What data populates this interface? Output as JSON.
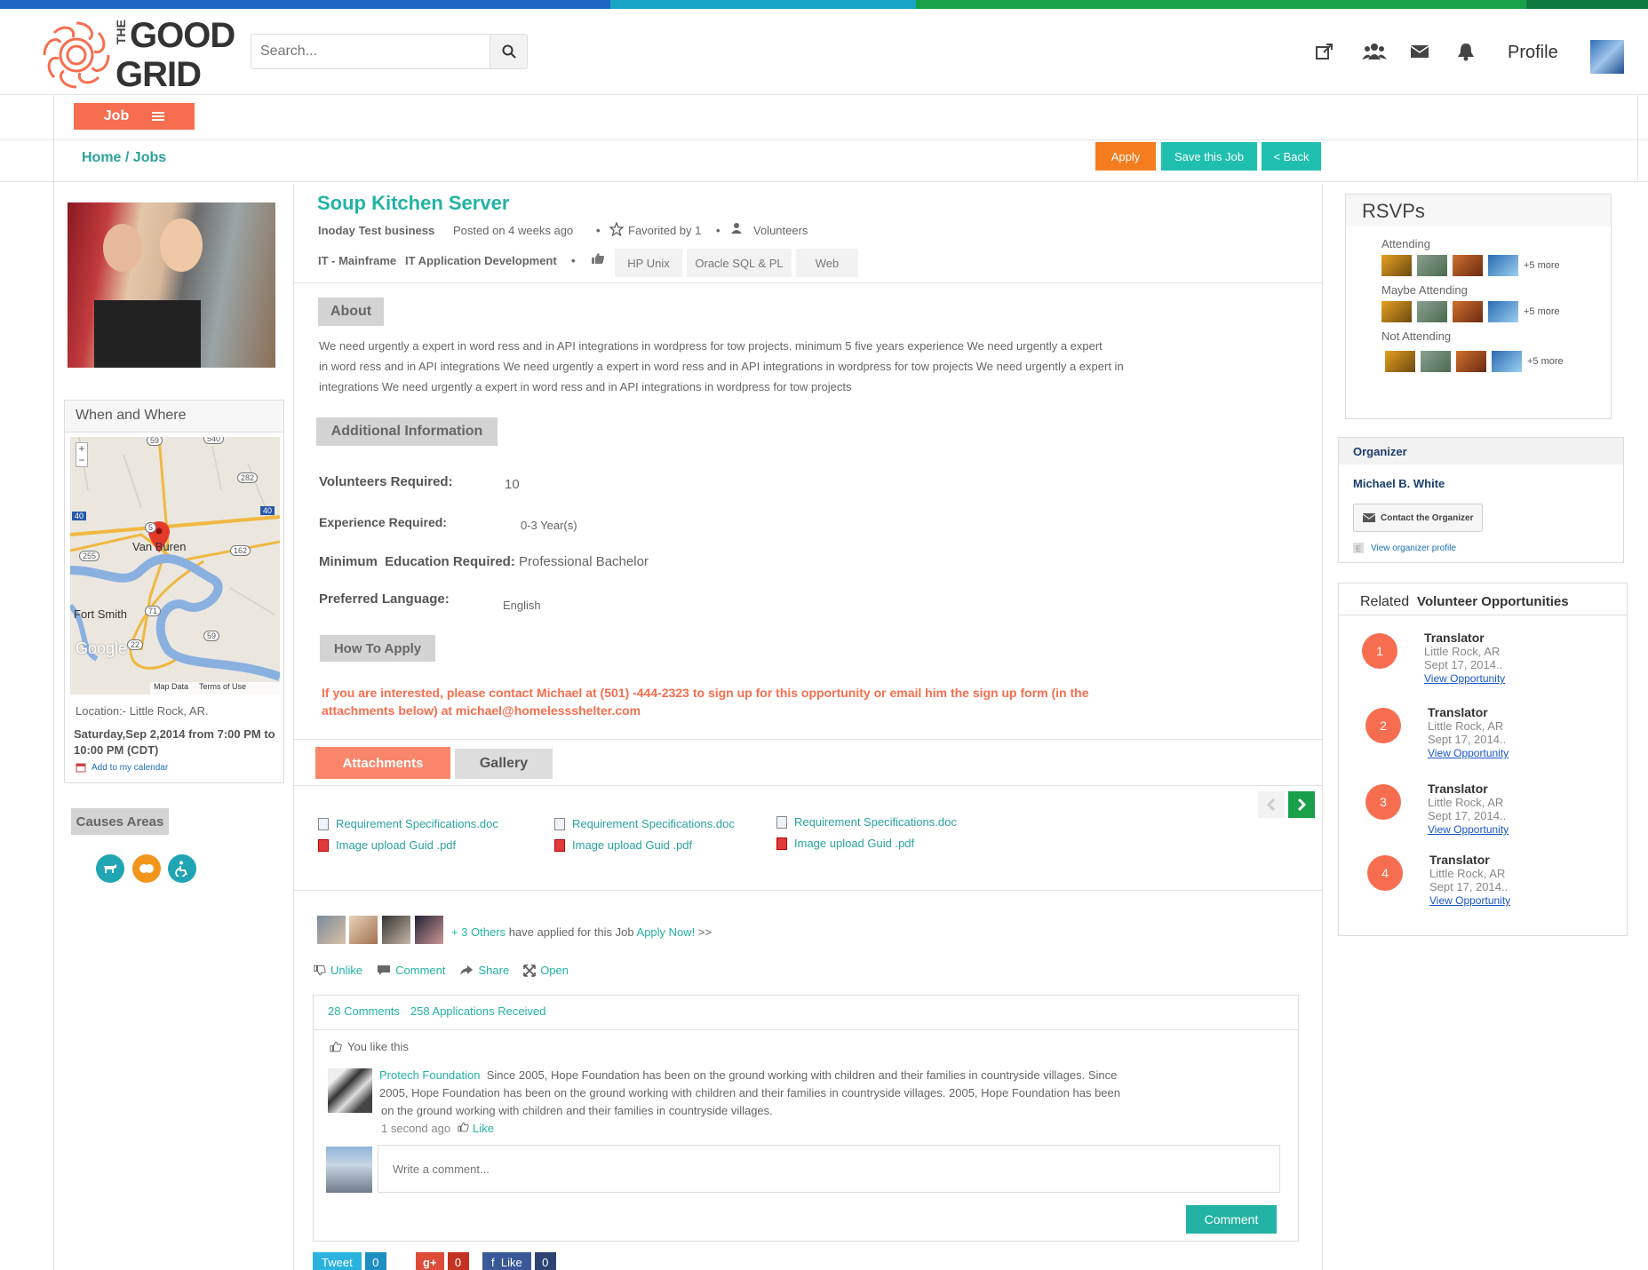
{
  "brand": {
    "logo_text_small": "THE",
    "logo_text_large_1": "GOOD",
    "logo_text_large_2": "GRID"
  },
  "colors": {
    "accent": "#22b3a4",
    "orange": "#f66e4f",
    "apply": "#f57c1f",
    "save": "#1fbfb0",
    "green": "#1a9f4a"
  },
  "search": {
    "placeholder": "Search..."
  },
  "header": {
    "profile_label": "Profile"
  },
  "subnav": {
    "job_tab": "Job"
  },
  "breadcrumb": {
    "home": "Home",
    "separator": " / ",
    "jobs": "Jobs"
  },
  "actions": {
    "apply": "Apply",
    "save": "Save this Job",
    "back": "< Back"
  },
  "job": {
    "title": "Soup Kitchen Server",
    "business": "Inoday Test business",
    "posted": "Posted on 4 weeks ago",
    "favorited": "Favorited by 1",
    "category": "Volunteers",
    "skill_1": "IT - Mainframe",
    "skill_2": "IT Application Development",
    "tags": [
      "HP Unix",
      "Oracle SQL & PL",
      "Web"
    ]
  },
  "about": {
    "heading": "About",
    "line_1": "We need urgently a expert in word ress and in API integrations in wordpress for tow projects. minimum 5 five years experience We need urgently a expert",
    "line_2": "in word ress and in API integrations We need urgently a expert in word ress and in API integrations in wordpress for tow projects We need urgently a expert in",
    "line_3": "integrations We need urgently a expert in word ress and in API integrations in wordpress for tow projects"
  },
  "additional": {
    "heading": "Additional Information",
    "volunteers_label": "Volunteers Required:",
    "volunteers_value": "10",
    "experience_label": "Experience Required:",
    "experience_value": "0-3 Year(s)",
    "education_label": "Minimum  Education Required:",
    "education_value": "Professional Bachelor",
    "language_label": "Preferred Language:",
    "language_value": "English"
  },
  "how_to_apply": {
    "heading": "How To Apply",
    "line_1": "If you are interested, please contact Michael at (501) -444-2323 to sign up for this opportunity or email him the sign up form (in the",
    "line_2": "attachments below) at michael@homelessshelter.com"
  },
  "tabs": {
    "attachments": "Attachments",
    "gallery": "Gallery"
  },
  "attachments": {
    "doc": "Requirement Specifications.doc",
    "pdf": "Image upload Guid .pdf"
  },
  "applicants": {
    "others": "+ 3 Others",
    "text": "have applied for this  Job",
    "apply_now": "Apply Now!",
    "arrows": ">>"
  },
  "social_actions": {
    "unlike": "Unlike",
    "comment": "Comment",
    "share": "Share",
    "open": "Open"
  },
  "comments": {
    "count": "28 Comments",
    "applications": "258 Applications Received",
    "you_like": "You like this",
    "author": "Protech Foundation",
    "line_1": "Since 2005, Hope Foundation has been on the ground working with children and their families in countryside villages. Since",
    "line_2": "2005, Hope Foundation has been on the ground working with children and their families in countryside villages. 2005, Hope Foundation has been",
    "line_3": "on the ground working with children and their families in countryside villages.",
    "time": "1 second ago",
    "like": "Like",
    "placeholder": "Write a comment...",
    "button": "Comment"
  },
  "share_buttons": {
    "tweet": "Tweet",
    "tweet_count": "0",
    "gplus": "g+",
    "gplus_count": "0",
    "fb": "f  Like",
    "fb_count": "0"
  },
  "sidebar": {
    "when_where": "When and Where",
    "map_labels": {
      "van_buren": "Van Buren",
      "fort_smith": "Fort Smith",
      "map_data": "Map Data",
      "terms": "Terms of Use",
      "google": "Google",
      "r59": "59",
      "r540": "540",
      "r282": "282",
      "r40a": "40",
      "r40b": "40",
      "r255": "255",
      "r162": "162",
      "r71": "71",
      "r22": "22",
      "r59b": "59",
      "r5": "5",
      "zoom_in": "+",
      "zoom_out": "−"
    },
    "location": "Location:- Little Rock, AR.",
    "date_1": "Saturday,Sep 2,2014 from 7:00 PM to",
    "date_2": "10:00 PM  (CDT)",
    "add_calendar": "Add to my calendar",
    "causes": "Causes Areas"
  },
  "rsvps": {
    "heading": "RSVPs",
    "attending": "Attending",
    "maybe": "Maybe Attending",
    "not_attending": "Not Attending",
    "more": "+5 more"
  },
  "organizer": {
    "heading": "Organizer",
    "name": "Michael B. White",
    "contact": "Contact the Organizer",
    "view_profile": "View organizer profile"
  },
  "related": {
    "heading_1": "Related",
    "heading_2": "Volunteer Opportunities",
    "items": [
      {
        "num": "1",
        "title": "Translator",
        "place": "Little Rock, AR",
        "date": "Sept 17, 2014..",
        "link": "View Opportunity"
      },
      {
        "num": "2",
        "title": "Translator",
        "place": "Little Rock, AR",
        "date": "Sept 17, 2014..",
        "link": "View Opportunity"
      },
      {
        "num": "3",
        "title": "Translator",
        "place": "Little Rock, AR",
        "date": "Sept 17, 2014..",
        "link": "View Opportunity"
      },
      {
        "num": "4",
        "title": "Translator",
        "place": "Little Rock, AR",
        "date": "Sept 17, 2014..",
        "link": "View Opportunity"
      }
    ]
  }
}
